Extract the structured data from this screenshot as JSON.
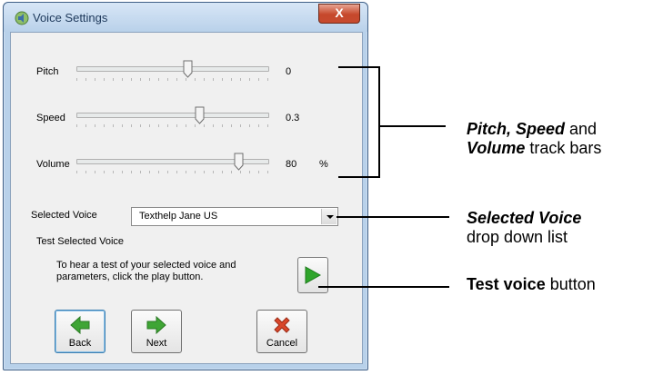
{
  "window": {
    "title": "Voice Settings",
    "close_label": "X"
  },
  "sliders": [
    {
      "label": "Pitch",
      "value": "0",
      "unit": ""
    },
    {
      "label": "Speed",
      "value": "0.3",
      "unit": ""
    },
    {
      "label": "Volume",
      "value": "80",
      "unit": "%"
    }
  ],
  "voice": {
    "label": "Selected Voice",
    "selected": "Texthelp Jane US",
    "test_heading": "Test Selected Voice",
    "test_description": "To hear a test of your selected voice and parameters, click the play button."
  },
  "buttons": {
    "back": "Back",
    "next": "Next",
    "cancel": "Cancel"
  },
  "callouts": {
    "trackbars": {
      "bold1": "Pitch, Speed",
      "and": " and",
      "bold2": "Volume",
      "rest": " track bars"
    },
    "dropdown": {
      "bold": "Selected Voice",
      "rest": "drop down list"
    },
    "test": {
      "bold": "Test voice",
      "rest": " button"
    }
  },
  "colors": {
    "arrow_green": "#3fa535",
    "cancel_red": "#d9472b",
    "play_green": "#2fa52b"
  }
}
